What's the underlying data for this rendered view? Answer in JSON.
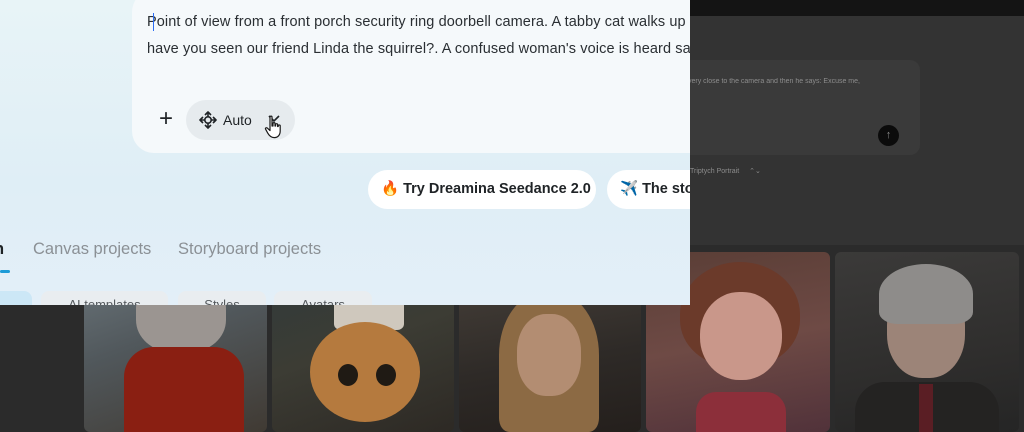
{
  "prompt": {
    "line1": "Point of view from a front porch security ring doorbell camera. A tabby cat walks up",
    "line2": "have you seen our friend Linda the squirrel?. A confused woman's voice is heard say"
  },
  "toolbar": {
    "add_label": "+",
    "mode_label": "Auto"
  },
  "promos": [
    {
      "emoji": "🔥",
      "label": "Try Dreamina Seedance 2.0"
    },
    {
      "emoji": "✈️",
      "label": "The stor"
    }
  ],
  "tabs": [
    {
      "label": "n"
    },
    {
      "label": "Canvas projects"
    },
    {
      "label": "Storyboard projects"
    }
  ],
  "filters": [
    {
      "label": "g"
    },
    {
      "label": "AI templates"
    },
    {
      "label": "Styles"
    },
    {
      "label": "Avatars"
    }
  ],
  "background": {
    "prompt_text": "very close to the camera and then he says: Excuse me,",
    "send_icon": "arrow-up-icon",
    "chip_label": "Triptych Portrait",
    "chip_chevron": "⌃⌄"
  },
  "colors": {
    "accent": "#1d9bd7",
    "panel_bg": "#e3eff8"
  }
}
